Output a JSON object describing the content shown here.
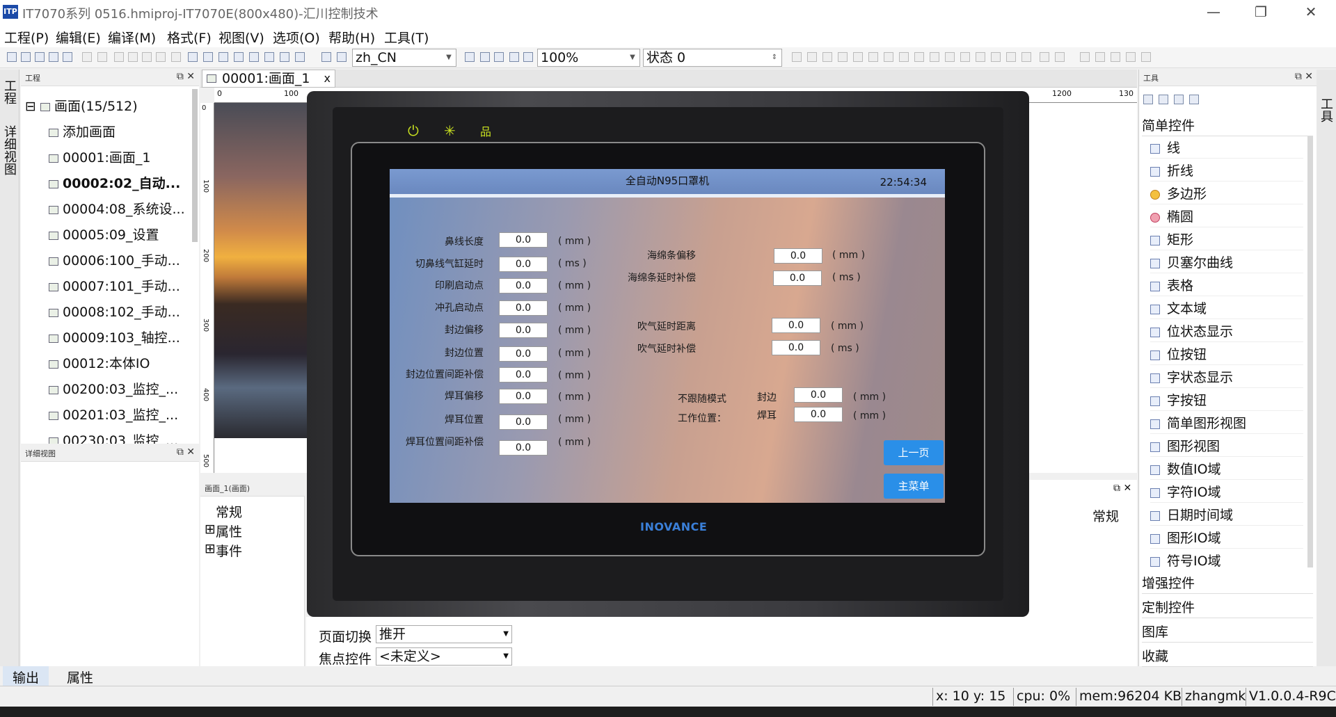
{
  "window": {
    "title": "IT7070系列 0516.hmiproj-IT7070E(800x480)-汇川控制技术",
    "logo": "ITP",
    "minimize": "—",
    "maximize": "❐",
    "close": "✕"
  },
  "menu": [
    "工程(P)",
    "编辑(E)",
    "编译(M)",
    "格式(F)",
    "视图(V)",
    "选项(O)",
    "帮助(H)",
    "工具(T)"
  ],
  "toolbar": {
    "language": "zh_CN",
    "zoom": "100%",
    "state": "状态 0"
  },
  "left_vtabs": [
    "工程",
    "详细视图"
  ],
  "project_panel": {
    "title": "工程",
    "root": "画面(15/512)",
    "items": [
      "添加画面",
      "00001:画面_1",
      "00002:02_自动...",
      "00004:08_系统设...",
      "00005:09_设置",
      "00006:100_手动...",
      "00007:101_手动...",
      "00008:102_手动...",
      "00009:103_轴控...",
      "00012:本体IO",
      "00200:03_监控_...",
      "00201:03_监控_...",
      "00230:03_监控_..."
    ]
  },
  "detail_panel": {
    "title": "详细视图"
  },
  "doc_tab": {
    "label": "00001:画面_1",
    "close": "x"
  },
  "ruler_h": [
    "0",
    "100",
    "1200",
    "130"
  ],
  "ruler_v": [
    "0",
    "100",
    "200",
    "300",
    "400",
    "500"
  ],
  "props_panel": {
    "title": "画面_1(画面)",
    "items": [
      "常规",
      "属性",
      "事件"
    ],
    "right_label": "常规",
    "rows": [
      {
        "label": "页面切换",
        "value": "推开"
      },
      {
        "label": "焦点控件",
        "value": "<未定义>"
      }
    ]
  },
  "toolbox": {
    "title": "工具",
    "category_simple": "简单控件",
    "items": [
      {
        "label": "线",
        "icon": "line-icon"
      },
      {
        "label": "折线",
        "icon": "polyline-icon"
      },
      {
        "label": "多边形",
        "icon": "polygon-icon"
      },
      {
        "label": "椭圆",
        "icon": "ellipse-icon"
      },
      {
        "label": "矩形",
        "icon": "rectangle-icon"
      },
      {
        "label": "贝塞尔曲线",
        "icon": "bezier-icon"
      },
      {
        "label": "表格",
        "icon": "table-icon"
      },
      {
        "label": "文本域",
        "icon": "text-icon"
      },
      {
        "label": "位状态显示",
        "icon": "bit-state-icon"
      },
      {
        "label": "位按钮",
        "icon": "bit-button-icon"
      },
      {
        "label": "字状态显示",
        "icon": "word-state-icon"
      },
      {
        "label": "字按钮",
        "icon": "word-button-icon"
      },
      {
        "label": "简单图形视图",
        "icon": "simple-graphic-icon"
      },
      {
        "label": "图形视图",
        "icon": "graphic-view-icon"
      },
      {
        "label": "数值IO域",
        "icon": "numeric-io-icon"
      },
      {
        "label": "字符IO域",
        "icon": "char-io-icon"
      },
      {
        "label": "日期时间域",
        "icon": "datetime-icon"
      },
      {
        "label": "图形IO域",
        "icon": "graphic-io-icon"
      },
      {
        "label": "符号IO域",
        "icon": "symbol-io-icon"
      }
    ],
    "categories": [
      "增强控件",
      "定制控件",
      "图库",
      "收藏"
    ]
  },
  "right_vtab": "工具",
  "bottom_tabs": [
    "输出",
    "属性"
  ],
  "status": {
    "coords": "x:  10 y:  15",
    "cpu": "cpu:   0%",
    "mem": "mem:96204 KB",
    "user": "zhangmk",
    "version": "V1.0.0.4-R9C"
  },
  "hmi": {
    "brand": "INOVANCE",
    "screen_title": "全自动N95口罩机",
    "time": "22:54:34",
    "left_params": [
      {
        "label": "鼻线长度",
        "value": "0.0",
        "unit": "( mm )"
      },
      {
        "label": "切鼻线气缸延时",
        "value": "0.0",
        "unit": "( ms )"
      },
      {
        "label": "印刷启动点",
        "value": "0.0",
        "unit": "( mm )"
      },
      {
        "label": "冲孔启动点",
        "value": "0.0",
        "unit": "( mm )"
      },
      {
        "label": "封边偏移",
        "value": "0.0",
        "unit": "( mm )"
      },
      {
        "label": "封边位置",
        "value": "0.0",
        "unit": "( mm )"
      },
      {
        "label": "封边位置间距补偿",
        "value": "0.0",
        "unit": "( mm )"
      },
      {
        "label": "焊耳偏移",
        "value": "0.0",
        "unit": "( mm )"
      },
      {
        "label": "焊耳位置",
        "value": "0.0",
        "unit": "( mm )"
      },
      {
        "label": "焊耳位置间距补偿",
        "value": "0.0",
        "unit": "( mm )"
      }
    ],
    "right_params": [
      {
        "label": "海绵条偏移",
        "value": "0.0",
        "unit": "( mm )"
      },
      {
        "label": "海绵条延时补偿",
        "value": "0.0",
        "unit": "( ms )"
      },
      {
        "label": "吹气延时距离",
        "value": "0.0",
        "unit": "( mm )"
      },
      {
        "label": "吹气延时补偿",
        "value": "0.0",
        "unit": "( ms )"
      }
    ],
    "mode_label_1": "不跟随模式",
    "mode_label_2": "工作位置：",
    "mode_params": [
      {
        "label": "封边",
        "value": "0.0",
        "unit": "( mm )"
      },
      {
        "label": "焊耳",
        "value": "0.0",
        "unit": "( mm )"
      }
    ],
    "btn_prev": "上一页",
    "btn_main": "主菜单"
  }
}
